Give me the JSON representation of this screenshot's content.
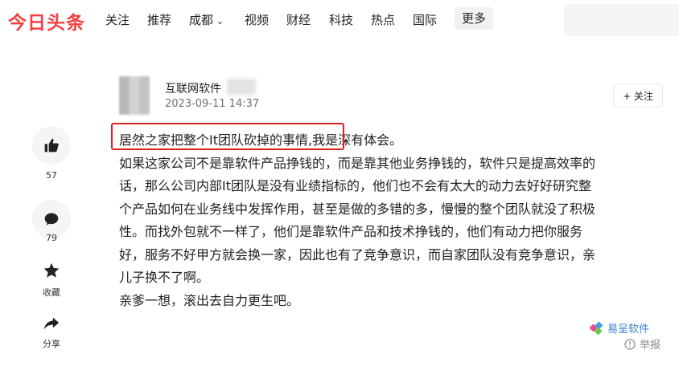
{
  "header": {
    "logo": "今日头条",
    "nav": [
      "关注",
      "推荐",
      "成都",
      "视频",
      "财经",
      "科技",
      "热点",
      "国际"
    ],
    "more": "更多"
  },
  "rail": {
    "like_count": "57",
    "comment_count": "79",
    "favorite_label": "收藏",
    "share_label": "分享"
  },
  "author": {
    "name": "互联网软件",
    "time": "2023-09-11 14:37",
    "follow_label": "+ 关注"
  },
  "post": {
    "highlighted": "居然之家把整个It团队砍掉的事情,",
    "line1_rest": "我是深有体会。",
    "line2": "如果这家公司不是靠软件产品挣钱的，而是靠其他业务挣钱的，软件只是提高效率的",
    "line3": "话，那么公司内部It团队是没有业绩指标的，他们也不会有太大的动力去好好研究整",
    "line4": "个产品如何在业务线中发挥作用，甚至是做的多错的多，慢慢的整个团队就没了积极",
    "line5": "性。而找外包就不一样了，他们是靠软件产品和技术挣钱的，他们有动力把你服务",
    "line6": "好，服务不好甲方就会换一家，因此也有了竞争意识，而自家团队没有竞争意识，亲",
    "line7": "儿子换不了啊。",
    "line8": "亲爹一想，滚出去自力更生吧。"
  },
  "watermark": "易呈软件",
  "report_label": "举报"
}
